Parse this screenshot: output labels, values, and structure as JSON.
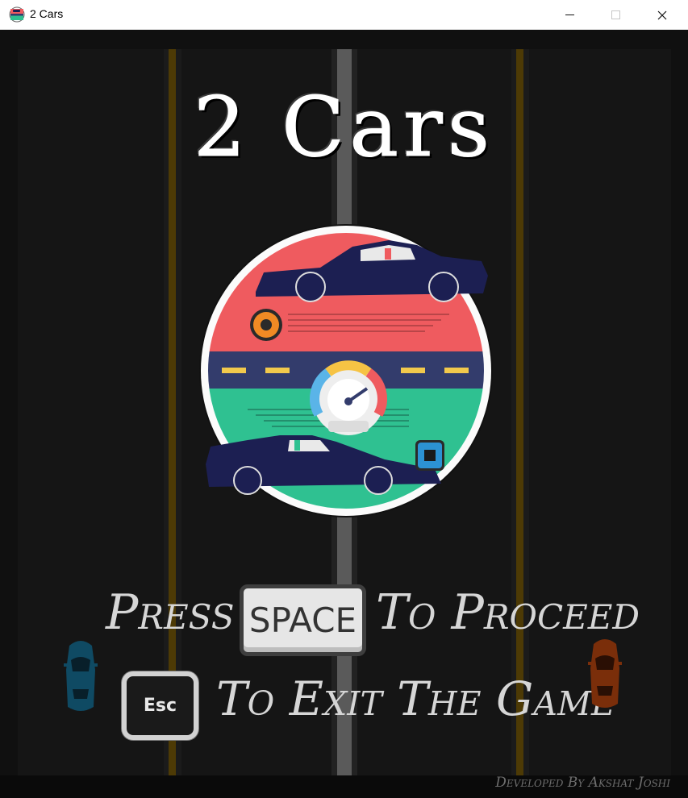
{
  "window": {
    "title": "2 Cars",
    "icon": "app-logo-icon",
    "controls": [
      "minimize-icon",
      "maximize-icon",
      "close-icon"
    ]
  },
  "game": {
    "title": "2 Cars",
    "press_label": "Press",
    "space_key_label": "SPACE",
    "proceed_label": "To Proceed",
    "esc_key_label": "Esc",
    "exit_label": "To Exit The Game",
    "credit": "Developed By Akshat Joshi"
  },
  "colors": {
    "road": "#151515",
    "side_line": "#4d3a05",
    "center_line": "#5a5a5a",
    "logo_red": "#ef5b5f",
    "logo_blue": "#333c6c",
    "logo_green": "#2fc191",
    "car_navy": "#1c1f52",
    "left_car": "#0f4a63",
    "right_car": "#7a2e0a",
    "orange_token": "#f08a24",
    "blue_token": "#2c92d3"
  }
}
